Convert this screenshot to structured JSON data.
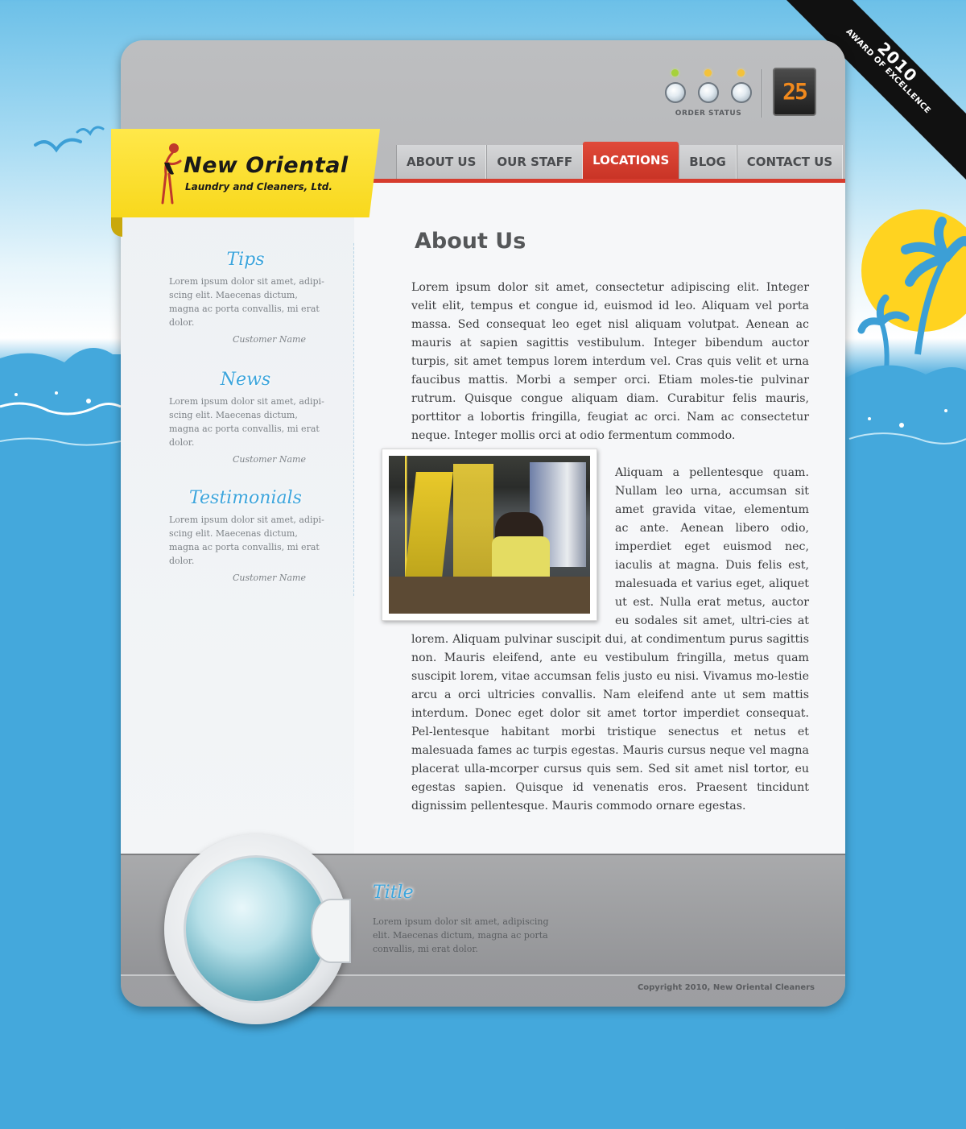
{
  "brand": {
    "name": "New Oriental",
    "tagline": "Laundry and Cleaners, Ltd."
  },
  "award": {
    "year": "2010",
    "title": "AWARD OF EXCELLENCE"
  },
  "order_status": {
    "label": "ORDER STATUS",
    "counter": "25"
  },
  "nav": {
    "items": [
      {
        "label": "ABOUT US",
        "active": false
      },
      {
        "label": "OUR STAFF",
        "active": false
      },
      {
        "label": "LOCATIONS",
        "active": true
      },
      {
        "label": "BLOG",
        "active": false
      },
      {
        "label": "CONTACT US",
        "active": false
      }
    ]
  },
  "sidebar": {
    "sections": [
      {
        "heading": "Tips",
        "body": "Lorem ipsum dolor sit amet, adipi-scing elit. Maecenas dictum, magna ac porta convallis, mi erat dolor.",
        "author": "Customer Name"
      },
      {
        "heading": "News",
        "body": "Lorem ipsum dolor sit amet, adipi-scing elit. Maecenas dictum, magna ac porta convallis, mi erat dolor.",
        "author": "Customer Name"
      },
      {
        "heading": "Testimonials",
        "body": "Lorem ipsum dolor sit amet, adipi-scing elit. Maecenas dictum, magna ac porta convallis, mi erat dolor.",
        "author": "Customer Name"
      }
    ]
  },
  "main": {
    "title": "About Us",
    "paragraphs": [
      "Lorem ipsum dolor sit amet, consectetur adipiscing elit. Integer velit elit, tempus et congue id, euismod id leo. Aliquam vel porta massa. Sed consequat leo eget nisl aliquam volutpat. Aenean ac mauris at sapien sagittis vestibulum. Integer bibendum auctor turpis, sit amet tempus lorem interdum vel. Cras quis velit et urna faucibus mattis. Morbi a semper orci. Etiam moles-tie pulvinar rutrum. Quisque congue aliquam diam. Curabitur felis mauris, porttitor a lobortis fringilla, feugiat ac orci. Nam ac consectetur neque. Integer mollis orci at odio fermentum commodo.",
      "Aliquam a pellentesque quam. Nullam leo urna, accumsan sit amet gravida vitae, elementum ac ante. Aenean libero odio, imperdiet eget euismod nec, iaculis at magna. Duis felis est, malesuada et varius eget, aliquet ut est. Nulla erat metus, auctor eu sodales sit amet, ultri-cies at lorem. Aliquam pulvinar suscipit dui, at condimentum purus sagittis non. Mauris eleifend, ante eu vestibulum fringilla, metus quam suscipit lorem, vitae accumsan felis justo eu nisi. Vivamus mo-lestie arcu a orci ultricies convallis. Nam eleifend ante ut sem mattis interdum. Donec eget dolor sit amet tortor imperdiet consequat. Pel-lentesque habitant morbi tristique senectus et netus et malesuada fames ac turpis egestas. Mauris cursus neque vel magna placerat ulla-mcorper cursus quis sem. Sed sit amet nisl tortor, eu egestas sapien. Quisque id venenatis eros. Praesent tincidunt dignissim pellentesque. Mauris commodo ornare egestas."
    ]
  },
  "footer": {
    "title": "Title",
    "body": "Lorem ipsum dolor sit amet, adipiscing elit. Maecenas dictum, magna ac porta convallis, mi erat dolor.",
    "copyright": "Copyright 2010, New Oriental Cleaners"
  },
  "colors": {
    "accent_red": "#d63c2e",
    "heading_blue": "#3da5dc",
    "logo_yellow": "#f8d81c",
    "sky_blue": "#44a8dc",
    "counter_orange": "#f0891d"
  }
}
